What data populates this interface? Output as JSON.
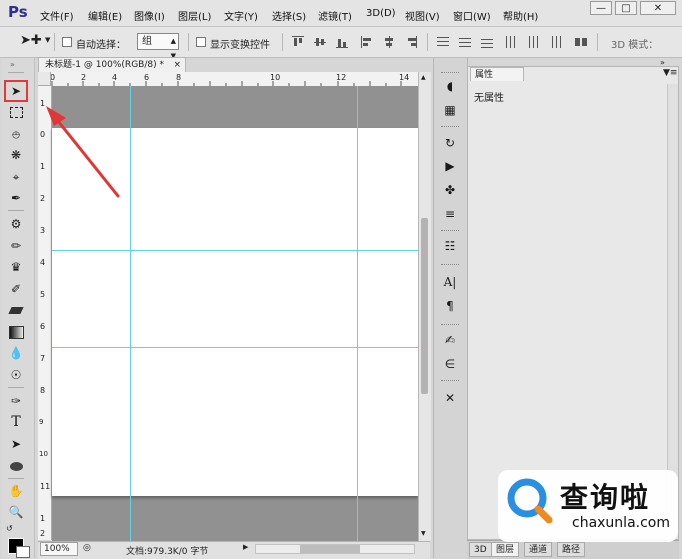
{
  "app": {
    "logo": "Ps",
    "menu": [
      "文件(F)",
      "编辑(E)",
      "图像(I)",
      "图层(L)",
      "文字(Y)",
      "选择(S)",
      "滤镜(T)",
      "3D(D)",
      "视图(V)",
      "窗口(W)",
      "帮助(H)"
    ],
    "window_controls": [
      "minimize-icon",
      "restore-icon",
      "close-icon"
    ]
  },
  "options_bar": {
    "auto_select_label": "自动选择：",
    "auto_select_checked": false,
    "group_value": "组",
    "show_transform_label": "显示变换控件",
    "show_transform_checked": false,
    "mode_label": "3D 模式："
  },
  "toolbar": {
    "tools": [
      "move-tool",
      "marquee-tool",
      "lasso-tool",
      "quick-select-tool",
      "crop-tool",
      "eyedropper-tool",
      "healing-brush-tool",
      "brush-tool",
      "clone-stamp-tool",
      "history-brush-tool",
      "eraser-tool",
      "gradient-tool",
      "blur-tool",
      "dodge-tool",
      "pen-tool",
      "type-tool",
      "path-select-tool",
      "ellipse-tool",
      "hand-tool",
      "zoom-tool"
    ],
    "type_glyph": "T"
  },
  "document": {
    "tab_title": "未标题-1 @ 100%(RGB/8) *",
    "tab_close": "×",
    "ruler_top": [
      "0",
      "2",
      "4",
      "6",
      "8",
      "10",
      "12",
      "14"
    ],
    "ruler_left": [
      "1",
      "0",
      "1",
      "2",
      "3",
      "4",
      "5",
      "6",
      "7",
      "8",
      "9",
      "10",
      "11",
      "1",
      "2"
    ]
  },
  "status": {
    "zoom": "100%",
    "doc_info": "文档:979.3K/0 字节"
  },
  "dock": {
    "glyph_A": "A|",
    "glyph_para": "¶"
  },
  "properties": {
    "tab_label": "属性",
    "content": "无属性"
  },
  "bottom_tabs": [
    "3D",
    "图层",
    "通道",
    "路径"
  ],
  "watermark": {
    "cn": "查询啦",
    "en": "chaxunla.com"
  },
  "colors": {
    "guide": "#63d2e4",
    "highlight": "#e23a3a",
    "canvas_bg": "#919191"
  }
}
